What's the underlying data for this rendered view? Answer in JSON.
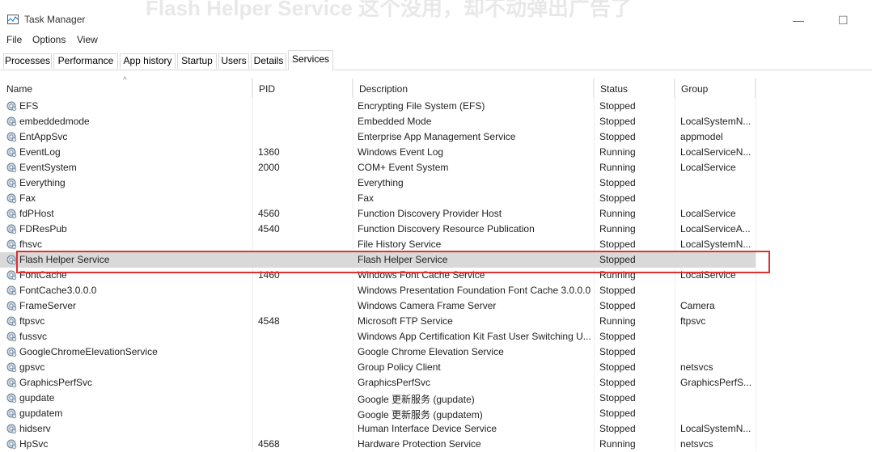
{
  "window": {
    "title": "Task Manager",
    "background_caption": "Flash Helper Service 这个没用，却不动弹出广告了",
    "minimize_glyph": "—",
    "maximize_glyph": "☐"
  },
  "menu": [
    "File",
    "Options",
    "View"
  ],
  "tabs": [
    "Processes",
    "Performance",
    "App history",
    "Startup",
    "Users",
    "Details",
    "Services"
  ],
  "active_tab": "Services",
  "columns": [
    "Name",
    "PID",
    "Description",
    "Status",
    "Group"
  ],
  "sort_indicator": "^",
  "services": [
    {
      "name": "EFS",
      "pid": "",
      "description": "Encrypting File System (EFS)",
      "status": "Stopped",
      "group": ""
    },
    {
      "name": "embeddedmode",
      "pid": "",
      "description": "Embedded Mode",
      "status": "Stopped",
      "group": "LocalSystemN..."
    },
    {
      "name": "EntAppSvc",
      "pid": "",
      "description": "Enterprise App Management Service",
      "status": "Stopped",
      "group": "appmodel"
    },
    {
      "name": "EventLog",
      "pid": "1360",
      "description": "Windows Event Log",
      "status": "Running",
      "group": "LocalServiceN..."
    },
    {
      "name": "EventSystem",
      "pid": "2000",
      "description": "COM+ Event System",
      "status": "Running",
      "group": "LocalService"
    },
    {
      "name": "Everything",
      "pid": "",
      "description": "Everything",
      "status": "Stopped",
      "group": ""
    },
    {
      "name": "Fax",
      "pid": "",
      "description": "Fax",
      "status": "Stopped",
      "group": ""
    },
    {
      "name": "fdPHost",
      "pid": "4560",
      "description": "Function Discovery Provider Host",
      "status": "Running",
      "group": "LocalService"
    },
    {
      "name": "FDResPub",
      "pid": "4540",
      "description": "Function Discovery Resource Publication",
      "status": "Running",
      "group": "LocalServiceA..."
    },
    {
      "name": "fhsvc",
      "pid": "",
      "description": "File History Service",
      "status": "Stopped",
      "group": "LocalSystemN..."
    },
    {
      "name": "Flash Helper Service",
      "pid": "",
      "description": "Flash Helper Service",
      "status": "Stopped",
      "group": ""
    },
    {
      "name": "FontCache",
      "pid": "1460",
      "description": "Windows Font Cache Service",
      "status": "Running",
      "group": "LocalService"
    },
    {
      "name": "FontCache3.0.0.0",
      "pid": "",
      "description": "Windows Presentation Foundation Font Cache 3.0.0.0",
      "status": "Stopped",
      "group": ""
    },
    {
      "name": "FrameServer",
      "pid": "",
      "description": "Windows Camera Frame Server",
      "status": "Stopped",
      "group": "Camera"
    },
    {
      "name": "ftpsvc",
      "pid": "4548",
      "description": "Microsoft FTP Service",
      "status": "Running",
      "group": "ftpsvc"
    },
    {
      "name": "fussvc",
      "pid": "",
      "description": "Windows App Certification Kit Fast User Switching U...",
      "status": "Stopped",
      "group": ""
    },
    {
      "name": "GoogleChromeElevationService",
      "pid": "",
      "description": "Google Chrome Elevation Service",
      "status": "Stopped",
      "group": ""
    },
    {
      "name": "gpsvc",
      "pid": "",
      "description": "Group Policy Client",
      "status": "Stopped",
      "group": "netsvcs"
    },
    {
      "name": "GraphicsPerfSvc",
      "pid": "",
      "description": "GraphicsPerfSvc",
      "status": "Stopped",
      "group": "GraphicsPerfS..."
    },
    {
      "name": "gupdate",
      "pid": "",
      "description": "Google 更新服务 (gupdate)",
      "status": "Stopped",
      "group": ""
    },
    {
      "name": "gupdatem",
      "pid": "",
      "description": "Google 更新服务 (gupdatem)",
      "status": "Stopped",
      "group": ""
    },
    {
      "name": "hidserv",
      "pid": "",
      "description": "Human Interface Device Service",
      "status": "Stopped",
      "group": "LocalSystemN..."
    },
    {
      "name": "HpSvc",
      "pid": "4568",
      "description": "Hardware Protection Service",
      "status": "Running",
      "group": "netsvcs"
    }
  ],
  "selected_service": "Flash Helper Service",
  "annotation_color": "#e03030",
  "row_icon": "service-gear-icon"
}
